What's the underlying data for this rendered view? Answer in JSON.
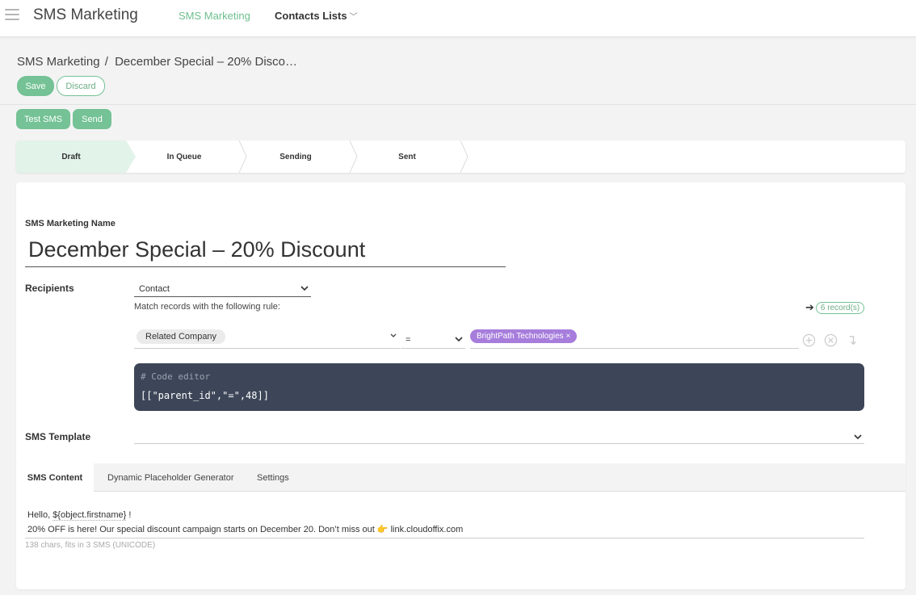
{
  "nav": {
    "app_title": "SMS Marketing",
    "link_active": "SMS Marketing",
    "link_contacts": "Contacts Lists"
  },
  "breadcrumb": {
    "root": "SMS Marketing",
    "current": "December Special – 20% Disco…"
  },
  "buttons": {
    "save": "Save",
    "discard": "Discard",
    "test_sms": "Test SMS",
    "send": "Send"
  },
  "stages": [
    "Draft",
    "In Queue",
    "Sending",
    "Sent"
  ],
  "form": {
    "name_label": "SMS Marketing Name",
    "name_value": "December Special – 20% Discount",
    "recipients_label": "Recipients",
    "recipients_model": "Contact",
    "match_text": "Match records with the following rule:",
    "records_count": "6 record(s)",
    "rule_field": "Related Company",
    "rule_operator": "=",
    "rule_value": "BrightPath Technologies",
    "code_comment": "# Code editor",
    "code_value": "[[\"parent_id\",\"=\",48]]",
    "template_label": "SMS Template"
  },
  "tabs": [
    "SMS Content",
    "Dynamic Placeholder Generator",
    "Settings"
  ],
  "content": {
    "line1_prefix": "Hello, ",
    "line1_placeholder": "${object.firstname}",
    "line1_suffix": " !",
    "line2": "20% OFF is here! Our special discount campaign starts on December 20. Don’t miss out 👉 link.cloudoffix.com",
    "char_count": "138 chars, fits in 3 SMS (UNICODE)"
  },
  "colors": {
    "accent": "#74c295",
    "tag": "#a77ddc",
    "code_bg": "#3d4658"
  }
}
